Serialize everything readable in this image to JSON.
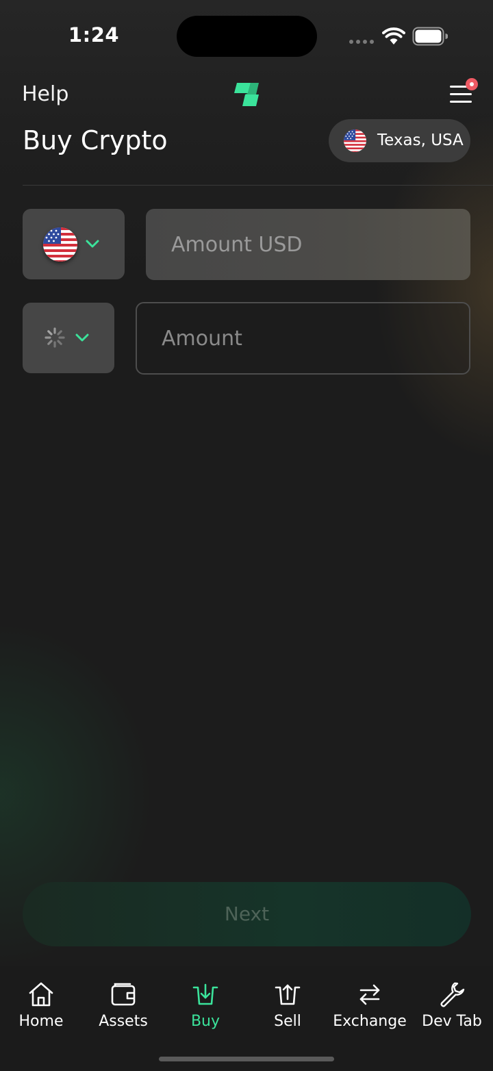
{
  "status_bar": {
    "time": "1:24"
  },
  "header": {
    "help_label": "Help",
    "logo_icon": "brand-logo-icon",
    "menu_icon": "hamburger-menu-icon",
    "notification_color": "#ef5a64"
  },
  "page": {
    "title": "Buy Crypto",
    "location": "Texas, USA",
    "location_flag": "us-flag-icon"
  },
  "fiat_row": {
    "currency_flag": "us-flag-icon",
    "placeholder": "Amount USD",
    "value": ""
  },
  "crypto_row": {
    "currency_icon": "loading-spinner-icon",
    "placeholder": "Amount",
    "value": ""
  },
  "next_button": {
    "label": "Next",
    "enabled": false
  },
  "tabs": [
    {
      "label": "Home",
      "icon": "home-icon",
      "active": false
    },
    {
      "label": "Assets",
      "icon": "wallet-icon",
      "active": false
    },
    {
      "label": "Buy",
      "icon": "buy-icon",
      "active": true
    },
    {
      "label": "Sell",
      "icon": "sell-icon",
      "active": false
    },
    {
      "label": "Exchange",
      "icon": "exchange-icon",
      "active": false
    },
    {
      "label": "Dev Tab",
      "icon": "wrench-icon",
      "active": false
    }
  ],
  "colors": {
    "accent": "#3be39b",
    "background": "#1c1c1c",
    "field": "#464646"
  }
}
